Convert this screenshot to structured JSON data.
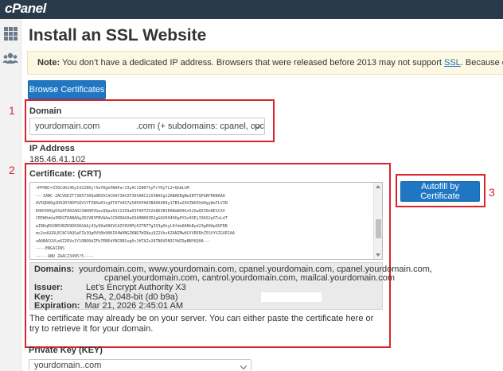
{
  "brand": {
    "logo_text": "cPanel"
  },
  "sidebar": {
    "items": [
      {
        "icon": "grid-icon"
      },
      {
        "icon": "users-icon"
      }
    ]
  },
  "page": {
    "title": "Install an SSL Website"
  },
  "notice": {
    "lead": "Note:",
    "text_before": " You don’t have a dedicated IP address. Browsers that were released before 2013 may not support ",
    "link": "SSL",
    "text_after": ". Because of this, users may see"
  },
  "buttons": {
    "browse": "Browse Certificates",
    "autofill": "Autofill by Certificate"
  },
  "annotations": {
    "box1": "1",
    "box2": "2",
    "box3": "3"
  },
  "domain": {
    "label": "Domain",
    "selected_left": "yourdomain.com",
    "selected_right": ".com (+ subdomains: cpanel, cpc"
  },
  "ip": {
    "label": "IP Address",
    "value": "185.46.41.102"
  },
  "certificate": {
    "label": "Certificate: (CRT)",
    "lines": [
      "<PP9BC=ZI0Cd6146y142286y!0a7RgkPBAPar13yAC1IN07SyFrYKyTL2=QGALhM",
      "---IANC-ZACV6EZT7385730Qa0RS5CACDAY3ACOF30SARC22V3BAVg2ZANAEBgNwINTTQPbRFRKBAAA",
      "AV5QD80g2D02RYADFGQV1YTZ6Kw03xg0TATVAS7p580VPA0ZBA0A409y17B3a29VZWV0Xd0gyWaTLVIN",
      "K0DCR0Qg5SGATA0ZA023AKREVGevQ9pu6S21359a03FA0TZV2b8DIB3EANaN99Gn52UwQ5Z0n8E1CXV",
      "CEEW0ddaIN5GTDANA0g2D2VN3FNVAAa1CDORAG0a03A0NK03D2gGGV0940Og0YGo0SEj33AS2pOTzLdT",
      "wIRDqE02N5VBZD9D836GAAj43y99a086VCAZV9V0Mj0Z7N7TgIO3gOhyL8fdm0ARkByd23g60ApOGFRB",
      "ms2odGGRLEC8CVAQSaPZk3Og0VV0b90KI64WVNGZKND7WINaj6Z2VkvKZANZMw0GYVRERhZ5SVYVZGVRIAA",
      "aA6BACGVLe6Z2EVo1Y1OBO0dZFb7ENEdYNCRBSxg0c1HTAZz26TNQVDN3IYWZ9pBNYKQ0A---",
      "----ENGAIINS",
      "---- AND ZAACZ3495?5----"
    ]
  },
  "details": {
    "domains_label": "Domains:",
    "domains_line1": "yourdomain.com, www.yourdomain.com, cpanel.yourdomain.com, cpanel.yourdomain.com,",
    "domains_line2": "cpanel.yourdomain.com, cantrol.yourdomain.com, mailcal.yourdomain.com",
    "issuer_label": "Issuer:",
    "issuer": "Let’s Encrypt Authority X3",
    "key_label": "Key:",
    "key": "RSA, 2,048-bit (d0            b9a)",
    "expiration_label": "Expiration:",
    "expiration": "Mar 21, 2026 2:45:01 AM"
  },
  "help_text": "The certificate may already be on your server. You can either paste the certificate here or try to retrieve it for your domain.",
  "private_key": {
    "label": "Private Key (KEY)",
    "selected": "yourdomain..com"
  }
}
